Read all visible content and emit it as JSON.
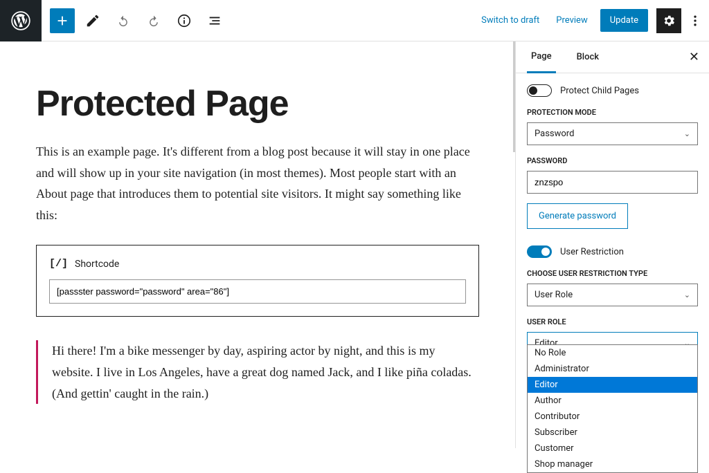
{
  "topbar": {
    "switch_draft": "Switch to draft",
    "preview": "Preview",
    "update": "Update"
  },
  "sidebar": {
    "tabs": {
      "page": "Page",
      "block": "Block"
    },
    "protect_child": "Protect Child Pages",
    "protection_mode_label": "PROTECTION MODE",
    "protection_mode_value": "Password",
    "password_label": "PASSWORD",
    "password_value": "znzspo",
    "generate_btn": "Generate password",
    "user_restriction": "User Restriction",
    "restriction_type_label": "CHOOSE USER RESTRICTION TYPE",
    "restriction_type_value": "User Role",
    "user_role_label": "USER ROLE",
    "user_role_value": "Editor",
    "role_options": [
      "No Role",
      "Administrator",
      "Editor",
      "Author",
      "Contributor",
      "Subscriber",
      "Customer",
      "Shop manager"
    ]
  },
  "editor": {
    "title": "Protected Page",
    "intro": "This is an example page. It's different from a blog post because it will stay in one place and will show up in your site navigation (in most themes). Most people start with an About page that introduces them to potential site visitors. It might say something like this:",
    "shortcode_label": "Shortcode",
    "shortcode_value": "[passster password=\"password\" area=\"86\"]",
    "quote": "Hi there! I'm a bike messenger by day, aspiring actor by night, and this is my website. I live in Los Angeles, have a great dog named Jack, and I like piña coladas. (And gettin' caught in the rain.)"
  }
}
